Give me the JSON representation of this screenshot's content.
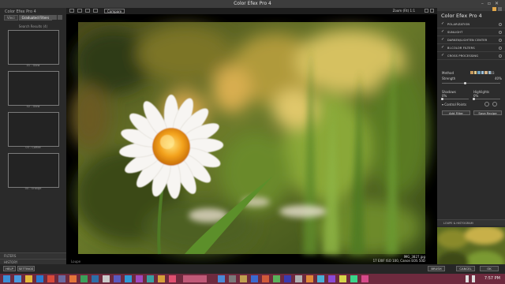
{
  "window": {
    "title": "Color Efex Pro 4"
  },
  "left_panel": {
    "app_title": "Color Efex Pro 4",
    "tabs": [
      {
        "label": "Vinci"
      },
      {
        "label": "Graduated Filters"
      }
    ],
    "search_results_label": "Search Results (4)",
    "thumbs": [
      {
        "label": "01 - Glow"
      },
      {
        "label": "02 - Glow"
      },
      {
        "label": "03 - Coffee"
      },
      {
        "label": "04 - Orange"
      }
    ],
    "sections": [
      {
        "label": "FILTERS"
      },
      {
        "label": "HISTORY"
      }
    ]
  },
  "toolbar": {
    "compare_label": "Compare",
    "zoom_label": "Zoom (Fit) 1:1"
  },
  "canvas": {
    "loupe_label": "Loupe",
    "image_filename": "IMG_3827.jpg",
    "image_meta": "17 EXIF ISO 100, Canon EOS 50D"
  },
  "right_panel": {
    "title": "Color Efex Pro 4",
    "filters": [
      {
        "name": "POLARIZATION"
      },
      {
        "name": "SUNLIGHT"
      },
      {
        "name": "DARKEN/LIGHTEN CENTER"
      },
      {
        "name": "BI-COLOR FILTERS"
      },
      {
        "name": "CROSS PROCESSING"
      }
    ],
    "method_label": "Method",
    "swatches": [
      "#c79a5e",
      "#e0c88a",
      "#6fa3c2",
      "#9fc1d9",
      "#d4b38a",
      "#8cb4cf"
    ],
    "swatch_value": "T03",
    "strength_label": "Strength",
    "strength_value": "40%",
    "strength_fraction": 0.4,
    "shadows_label": "Shadows",
    "highlights_label": "Highlights",
    "shadows_value": "0%",
    "highlights_value": "0%",
    "control_points_label": "Control Points",
    "add_filter_label": "Add Filter",
    "save_recipe_label": "Save Recipe",
    "histogram_label": "LOUPE & HISTOGRAM"
  },
  "bottom_bar": {
    "help_label": "HELP",
    "settings_label": "SETTINGS",
    "brush_label": "BRUSH",
    "cancel_label": "CANCEL",
    "ok_label": "OK"
  },
  "taskbar": {
    "time": "7:57 PM"
  },
  "colors": {
    "accent": "#6e2a3e",
    "panel": "#2a2a2a"
  }
}
